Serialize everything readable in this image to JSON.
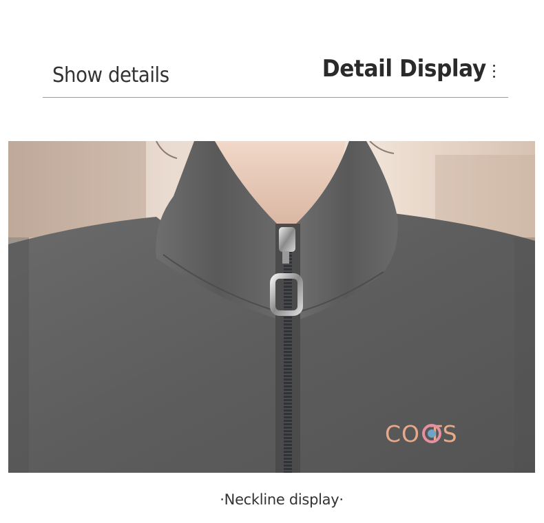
{
  "header": {
    "left_title": "Show details",
    "right_title": "Detail Display"
  },
  "photo": {
    "embroidery_text": "CO TS",
    "colors": {
      "fabric": "#5f5f5f",
      "background": "#e8d9cc",
      "embroidery": "#e8a98a"
    }
  },
  "caption": "·Neckline display·"
}
